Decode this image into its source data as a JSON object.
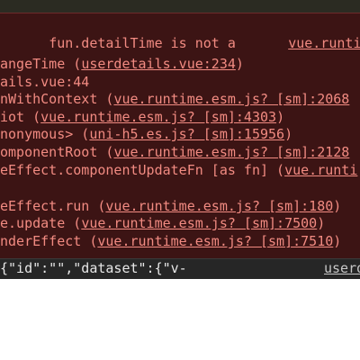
{
  "error": {
    "message": "fun.detailTime is not a",
    "message_source": "vue.runtime.es",
    "stack": [
      {
        "fn": "angeTime (",
        "source": "userdetails.vue:234",
        "tail": ")"
      },
      {
        "fn": "ails.vue:44",
        "source": "",
        "tail": ""
      },
      {
        "fn": "nWithContext (",
        "source": "vue.runtime.esm.js? [sm]:2068",
        "tail": ""
      },
      {
        "fn": "iot (",
        "source": "vue.runtime.esm.js? [sm]:4303",
        "tail": ")"
      },
      {
        "fn": "nonymous> (",
        "source": "uni-h5.es.js? [sm]:15956",
        "tail": ")"
      },
      {
        "fn": "omponentRoot (",
        "source": "vue.runtime.esm.js? [sm]:2128",
        "tail": ""
      },
      {
        "fn": "eEffect.componentUpdateFn [as fn] (",
        "source": "vue.runti",
        "tail": ""
      },
      {
        "fn": "eEffect.run (",
        "source": "vue.runtime.esm.js? [sm]:180",
        "tail": ")"
      },
      {
        "fn": "e.update (",
        "source": "vue.runtime.esm.js? [sm]:7500",
        "tail": ")"
      },
      {
        "fn": "nderEffect (",
        "source": "vue.runtime.esm.js? [sm]:7510",
        "tail": ")"
      }
    ]
  },
  "log": {
    "text": "{\"id\":\"\",\"dataset\":{\"v-",
    "source": "userd"
  },
  "colors": {
    "error_text": "#f28b82",
    "error_bg": "#3c1414",
    "log_bg": "#262626",
    "log_text": "#e8e8e8"
  }
}
